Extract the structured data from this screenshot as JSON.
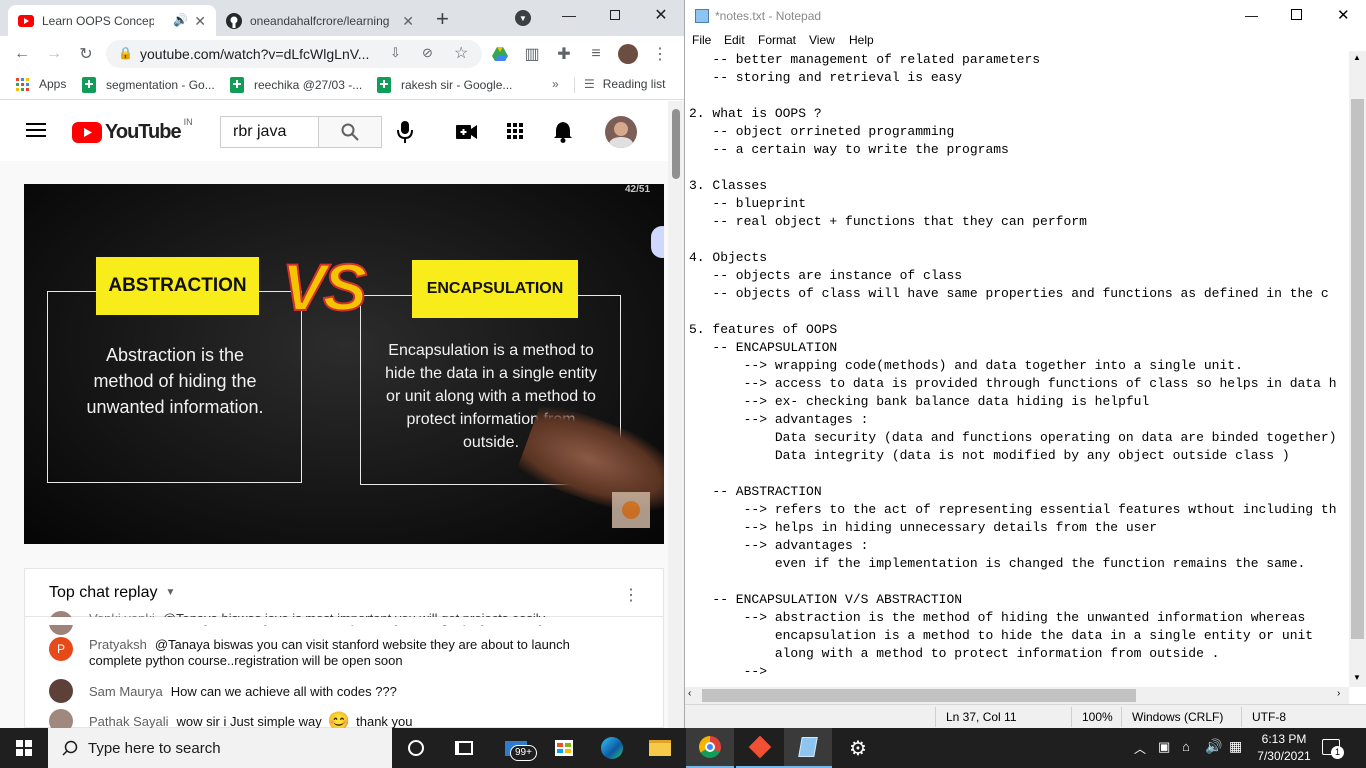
{
  "chrome": {
    "tabs": [
      {
        "title": "Learn OOPS Concepts",
        "active": true
      },
      {
        "title": "oneandahalfcrore/learning",
        "active": false
      }
    ],
    "url": "youtube.com/watch?v=dLfcWlgLnV...",
    "bookmarks": [
      "Apps",
      "segmentation - Go...",
      "reechika @27/03 -...",
      "rakesh sir - Google...",
      "Reading list"
    ]
  },
  "youtube": {
    "logo_text": "YouTube",
    "country": "IN",
    "search_value": "rbr java",
    "video": {
      "counter": "42/51",
      "left_title": "ABSTRACTION",
      "vs": "VS",
      "right_title": "ENCAPSULATION",
      "left_text": [
        "Abstraction is the",
        "method of hiding the",
        "unwanted information."
      ],
      "right_text": [
        "Encapsulation is a method to",
        "hide the data in a single entity",
        "or unit along with a method to",
        "protect information from",
        "outside."
      ]
    },
    "chat": {
      "header": "Top chat replay",
      "messages": [
        {
          "author": "Venki venki",
          "text": "@Tanaya biswas java is most important you will get projects easily",
          "avatar_color": "#8d6e63"
        },
        {
          "author": "Pratyaksh",
          "text": "@Tanaya biswas you can visit stanford website they are about to launch",
          "text2": "complete python course..registration will be open soon",
          "avatar_color": "#e64a19",
          "avatar_letter": "P"
        },
        {
          "author": "Sam Maurya",
          "text": "How can we achieve all with codes ???",
          "avatar_color": "#5d4037"
        },
        {
          "author": "Pathak Sayali",
          "text": "wow sir i Just simple way",
          "text_after": "thank you",
          "emoji": "😊",
          "avatar_color": "#a1887f"
        }
      ]
    }
  },
  "notepad": {
    "title": "*notes.txt - Notepad",
    "menu": [
      "File",
      "Edit",
      "Format",
      "View",
      "Help"
    ],
    "lines": [
      "   -- better management of related parameters",
      "   -- storing and retrieval is easy",
      "",
      "2. what is OOPS ?",
      "   -- object orrineted programming",
      "   -- a certain way to write the programs",
      "",
      "3. Classes",
      "   -- blueprint",
      "   -- real object + functions that they can perform",
      "",
      "4. Objects",
      "   -- objects are instance of class",
      "   -- objects of class will have same properties and functions as defined in the c",
      "",
      "5. features of OOPS",
      "   -- ENCAPSULATION",
      "       --> wrapping code(methods) and data together into a single unit.",
      "       --> access to data is provided through functions of class so helps in data h",
      "       --> ex- checking bank balance data hiding is helpful",
      "       --> advantages :",
      "           Data security (data and functions operating on data are binded together)",
      "           Data integrity (data is not modified by any object outside class )",
      "",
      "   -- ABSTRACTION",
      "       --> refers to the act of representing essential features wthout including th",
      "       --> helps in hiding unnecessary details from the user",
      "       --> advantages :",
      "           even if the implementation is changed the function remains the same.",
      "",
      "   -- ENCAPSULATION V/S ABSTRACTION",
      "       --> abstraction is the method of hiding the unwanted information whereas",
      "           encapsulation is a method to hide the data in a single entity or unit",
      "           along with a method to protect information from outside .",
      "       -->"
    ],
    "status": {
      "position": "Ln 37, Col 11",
      "zoom": "100%",
      "eol": "Windows (CRLF)",
      "encoding": "UTF-8"
    }
  },
  "taskbar": {
    "search_placeholder": "Type here to search",
    "mail_badge": "99+",
    "time": "6:13 PM",
    "date": "7/30/2021",
    "notification_count": "1"
  }
}
